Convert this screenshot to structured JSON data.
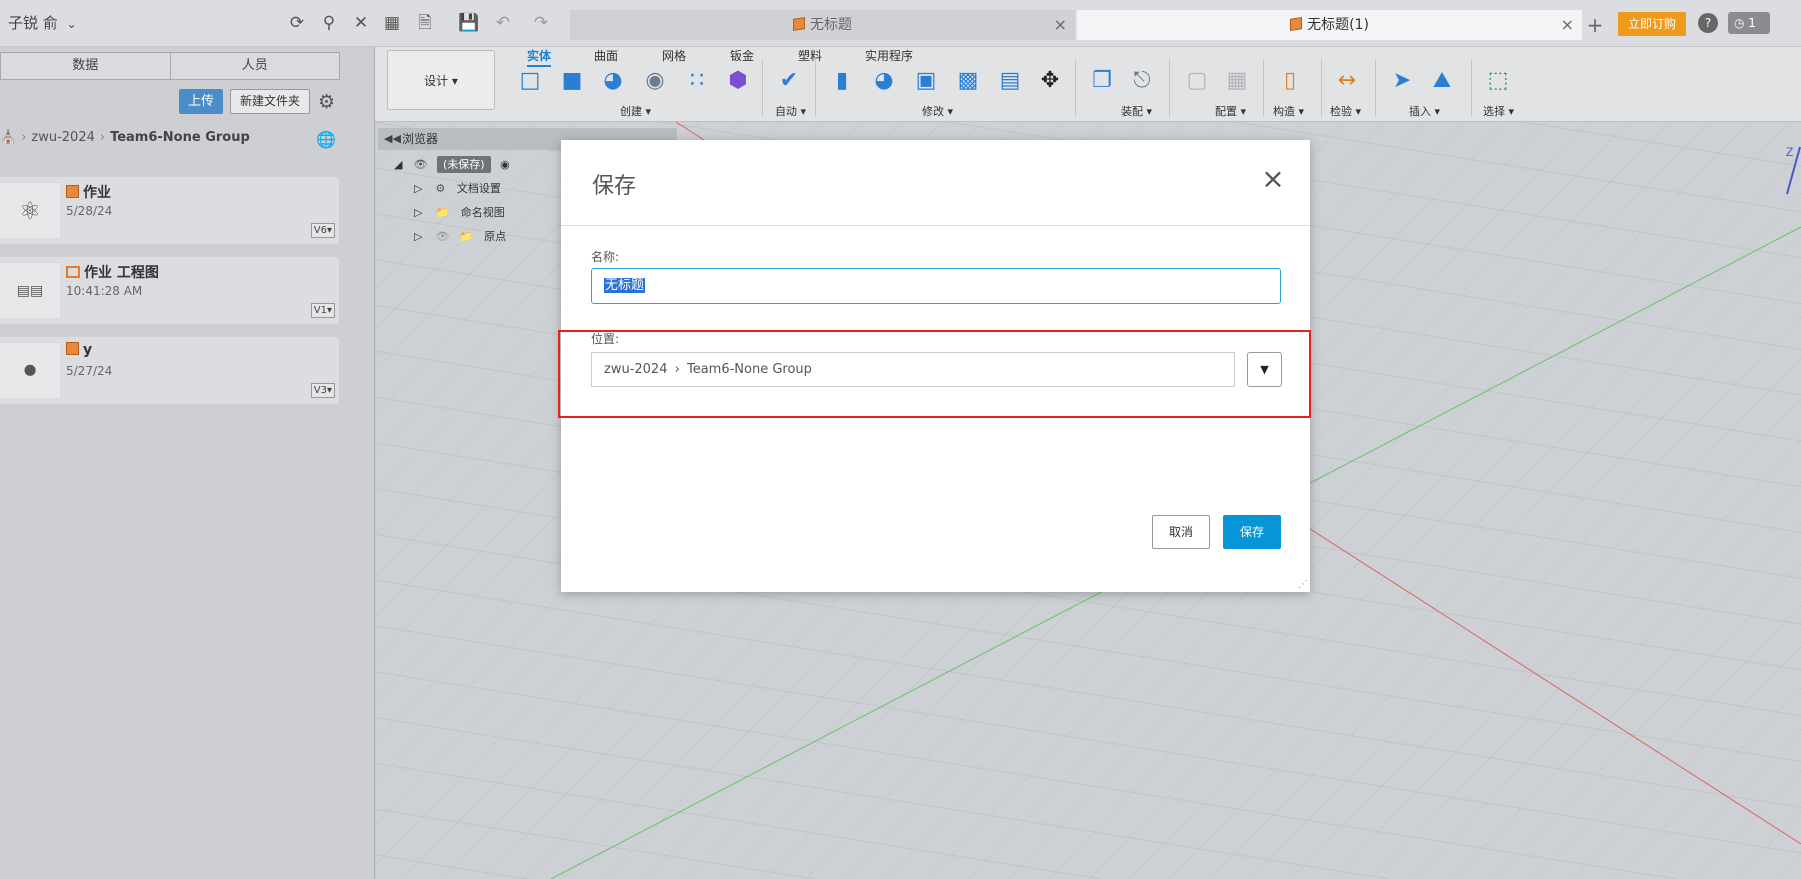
{
  "topbar": {
    "user": "子锐 俞",
    "tabs": [
      {
        "label": "无标题",
        "active": false
      },
      {
        "label": "无标题(1)",
        "active": true
      }
    ],
    "subscribe_label": "立即订购",
    "job_count": "1"
  },
  "data_panel": {
    "tabs": [
      "数据",
      "人员"
    ],
    "upload_label": "上传",
    "new_folder_label": "新建文件夹",
    "breadcrumb": [
      "zwu-2024",
      "Team6-None Group"
    ],
    "files": [
      {
        "name": "作业",
        "date": "5/28/24",
        "version": "V6",
        "type": "design"
      },
      {
        "name": "作业 工程图",
        "date": "10:41:28 AM",
        "version": "V1",
        "type": "drawing"
      },
      {
        "name": "y",
        "date": "5/27/24",
        "version": "V3",
        "type": "design"
      }
    ]
  },
  "toolbar": {
    "workspace": "设计",
    "ribbon_tabs": [
      "实体",
      "曲面",
      "网格",
      "钣金",
      "塑料",
      "实用程序"
    ],
    "active_tab": "实体",
    "groups": [
      "创建",
      "自动",
      "修改",
      "装配",
      "配置",
      "构造",
      "检验",
      "插入",
      "选择"
    ]
  },
  "browser": {
    "title": "浏览器",
    "root_label": "(未保存)",
    "items": [
      "文档设置",
      "命名视图",
      "原点"
    ]
  },
  "dialog": {
    "title": "保存",
    "name_label": "名称:",
    "name_value": "无标题",
    "location_label": "位置:",
    "location_path": [
      "zwu-2024",
      "Team6-None Group"
    ],
    "cancel_label": "取消",
    "save_label": "保存"
  },
  "colors": {
    "accent_blue": "#0696d7",
    "highlight_red": "#e32222",
    "subscribe_orange": "#f09a1c",
    "file_orange": "#e58a3b"
  },
  "viewcube_axis_label": "Z"
}
